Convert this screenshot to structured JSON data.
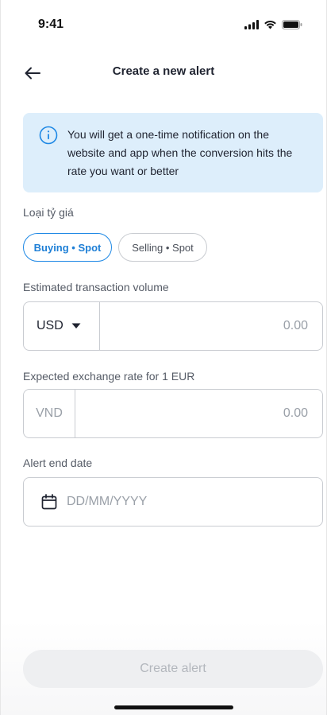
{
  "status_bar": {
    "time": "9:41",
    "icons": [
      "signal-icon",
      "wifi-icon",
      "battery-icon"
    ]
  },
  "header": {
    "back_icon": "arrow-left-icon",
    "title": "Create a new alert"
  },
  "info_banner": {
    "icon": "info-icon",
    "text": "You will get a one-time notification on the website and app when the conversion hits the rate you want or better"
  },
  "rate_type": {
    "label": "Loại tỷ giá",
    "options": [
      {
        "label": "Buying • Spot",
        "selected": true
      },
      {
        "label": "Selling • Spot",
        "selected": false
      }
    ]
  },
  "volume": {
    "label": "Estimated transaction volume",
    "currency": "USD",
    "placeholder": "0.00"
  },
  "rate": {
    "label": "Expected exchange rate for 1 EUR",
    "currency": "VND",
    "placeholder": "0.00"
  },
  "end_date": {
    "label": "Alert end date",
    "placeholder": "DD/MM/YYYY",
    "icon": "calendar-icon"
  },
  "actions": {
    "create_label": "Create alert"
  },
  "colors": {
    "accent": "#1e88e5",
    "banner_bg": "#ddeefb",
    "disabled_bg": "#eeeff1",
    "disabled_text": "#b3b7bd"
  }
}
